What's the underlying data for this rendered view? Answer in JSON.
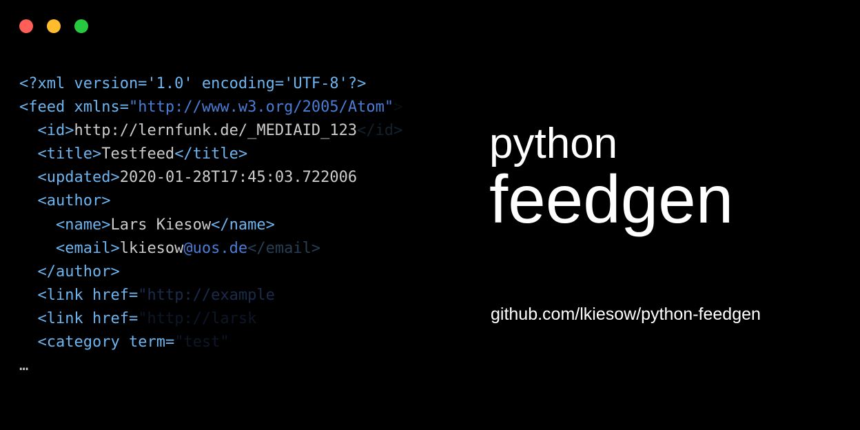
{
  "traffic_lights": {
    "red": "close",
    "yellow": "minimize",
    "green": "maximize"
  },
  "code": {
    "line1_decl": "<?xml version='1.0' encoding='UTF-8'?>",
    "line2_open": "<feed",
    "line2_attr": " xmlns=",
    "line2_val": "\"http://www.w3.org/2005/Atom\"",
    "line2_close": ">",
    "line3_open": "<id>",
    "line3_text": "http://lernfunk.de/_MEDIAID_123",
    "line3_close": "</id>",
    "line4_open": "<title>",
    "line4_text": "Testfeed",
    "line4_close": "</title>",
    "line5_open": "<updated>",
    "line5_text": "2020-01-28T17:45:03.722006",
    "line6_open": "<author>",
    "line7_open": "<name>",
    "line7_text": "Lars Kiesow",
    "line7_close": "</name>",
    "line8_open": "<email>",
    "line8_text": "lkiesow",
    "line8_email": "@uos.de",
    "line8_close": "</email>",
    "line9_close": "</author>",
    "line10_open": "<link",
    "line10_attr": " href=",
    "line10_val": "\"http://example",
    "line11_open": "<link",
    "line11_attr": " href=",
    "line11_val": "\"http://larsk",
    "line12_open": "<category",
    "line12_attr": " term=",
    "line12_val": "\"test\"",
    "ellipsis": "…"
  },
  "title": {
    "small": "python",
    "large": "feedgen"
  },
  "url": "github.com/lkiesow/python-feedgen"
}
